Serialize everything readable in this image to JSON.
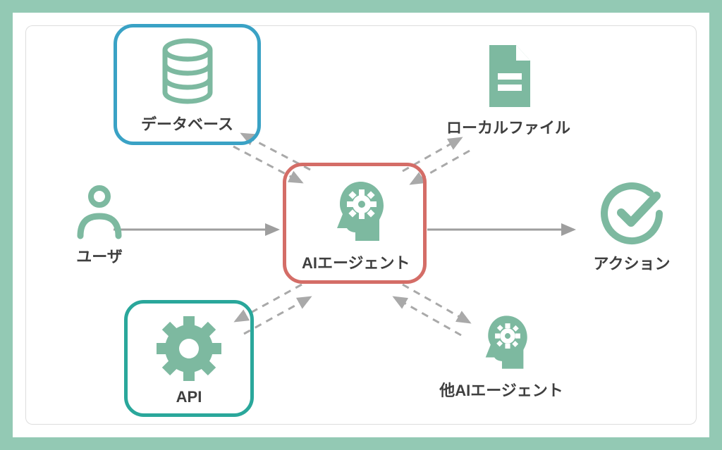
{
  "nodes": {
    "user": {
      "label": "ユーザ"
    },
    "database": {
      "label": "データベース"
    },
    "agent": {
      "label": "AIエージェント"
    },
    "localfile": {
      "label": "ローカルファイル"
    },
    "api": {
      "label": "API"
    },
    "otheragent": {
      "label": "他AIエージェント"
    },
    "action": {
      "label": "アクション"
    }
  },
  "colors": {
    "frame": "#93c9b4",
    "icon": "#7db9a0",
    "box_blue": "#3aa2c5",
    "box_red": "#d46d67",
    "box_teal": "#2aa79b",
    "arrow_solid": "#9e9e9e",
    "arrow_dashed": "#a9a9a9"
  },
  "connections": [
    {
      "from": "user",
      "to": "agent",
      "style": "solid",
      "dir": "one"
    },
    {
      "from": "agent",
      "to": "action",
      "style": "solid",
      "dir": "one"
    },
    {
      "from": "database",
      "to": "agent",
      "style": "dashed",
      "dir": "both"
    },
    {
      "from": "localfile",
      "to": "agent",
      "style": "dashed",
      "dir": "both"
    },
    {
      "from": "api",
      "to": "agent",
      "style": "dashed",
      "dir": "both"
    },
    {
      "from": "otheragent",
      "to": "agent",
      "style": "dashed",
      "dir": "both"
    }
  ]
}
